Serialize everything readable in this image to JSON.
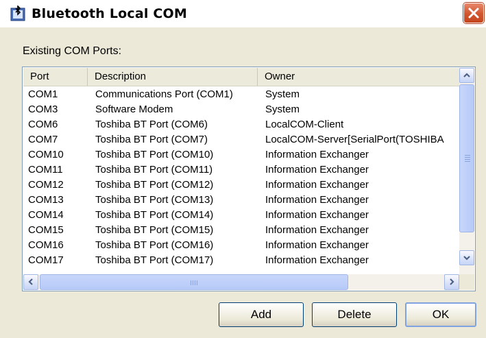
{
  "window": {
    "title": "Bluetooth Local COM",
    "icon": "bluetooth-com-app-icon"
  },
  "section_label": "Existing COM Ports:",
  "table": {
    "columns": [
      "Port",
      "Description",
      "Owner"
    ],
    "rows": [
      {
        "port": "COM1",
        "description": "Communications Port (COM1)",
        "owner": "System"
      },
      {
        "port": "COM3",
        "description": "Software Modem",
        "owner": "System"
      },
      {
        "port": "COM6",
        "description": "Toshiba BT Port (COM6)",
        "owner": "LocalCOM-Client"
      },
      {
        "port": "COM7",
        "description": "Toshiba BT Port (COM7)",
        "owner": "LocalCOM-Server[SerialPort(TOSHIBA"
      },
      {
        "port": "COM10",
        "description": "Toshiba BT Port (COM10)",
        "owner": "Information Exchanger"
      },
      {
        "port": "COM11",
        "description": "Toshiba BT Port (COM11)",
        "owner": "Information Exchanger"
      },
      {
        "port": "COM12",
        "description": "Toshiba BT Port (COM12)",
        "owner": "Information Exchanger"
      },
      {
        "port": "COM13",
        "description": "Toshiba BT Port (COM13)",
        "owner": "Information Exchanger"
      },
      {
        "port": "COM14",
        "description": "Toshiba BT Port (COM14)",
        "owner": "Information Exchanger"
      },
      {
        "port": "COM15",
        "description": "Toshiba BT Port (COM15)",
        "owner": "Information Exchanger"
      },
      {
        "port": "COM16",
        "description": "Toshiba BT Port (COM16)",
        "owner": "Information Exchanger"
      },
      {
        "port": "COM17",
        "description": "Toshiba BT Port (COM17)",
        "owner": "Information Exchanger"
      }
    ]
  },
  "buttons": {
    "add": "Add",
    "delete": "Delete",
    "ok": "OK"
  },
  "icons": {
    "close": "close-icon",
    "scroll_up": "arrow-up-icon",
    "scroll_down": "arrow-down-icon",
    "scroll_left": "arrow-left-icon",
    "scroll_right": "arrow-right-icon"
  },
  "colors": {
    "face": "#ece9d8",
    "close_button": "#d0552d",
    "scrollbar": "#c1d3fb"
  }
}
